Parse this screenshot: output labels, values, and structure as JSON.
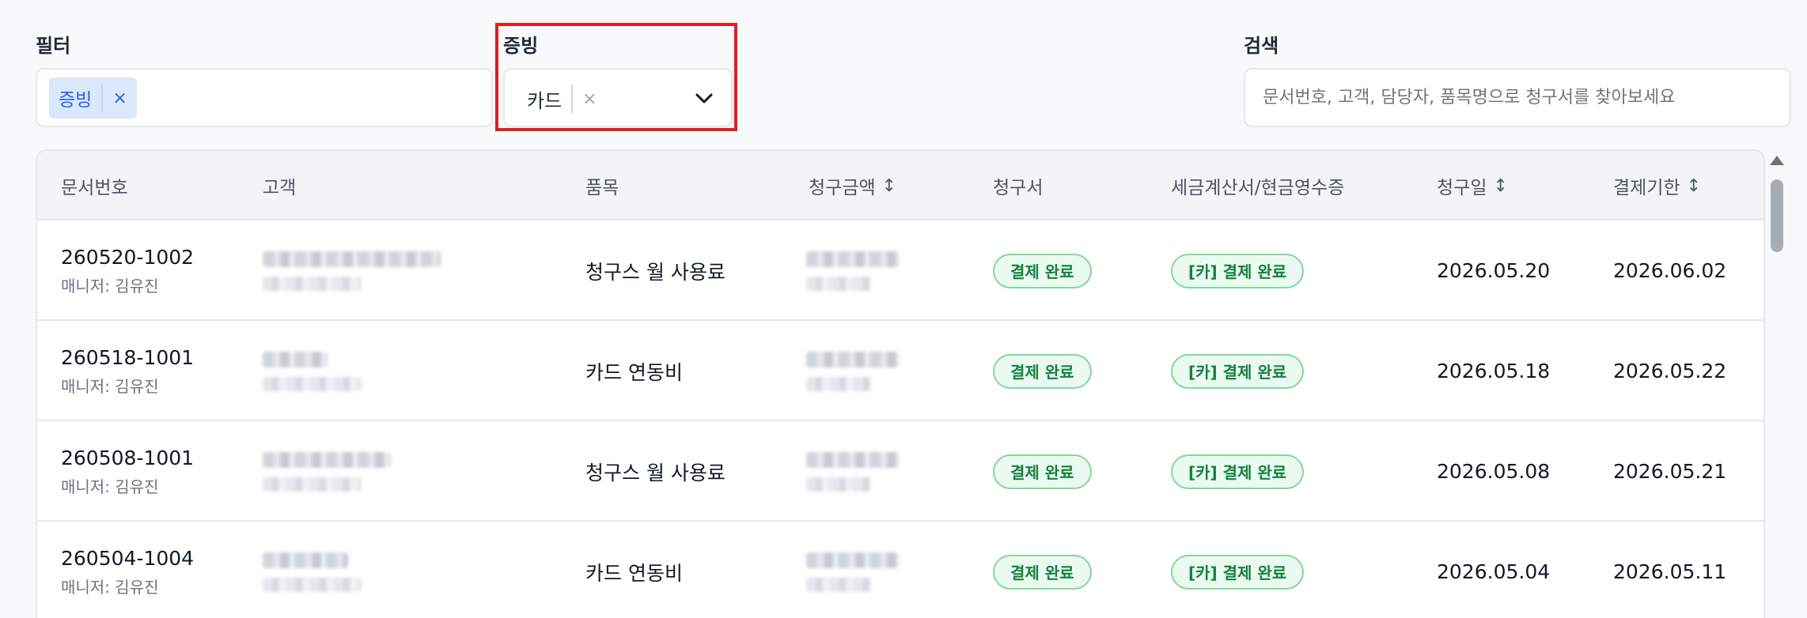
{
  "filters": {
    "filter_label": "필터",
    "filter_chip": "증빙",
    "evidence_label": "증빙",
    "evidence_value": "카드",
    "search_label": "검색",
    "search_placeholder": "문서번호, 고객, 담당자, 품목명으로 청구서를 찾아보세요"
  },
  "icons": {
    "remove": "×",
    "chevron": "chevron-down-icon",
    "sort": "↕"
  },
  "table": {
    "headers": [
      "문서번호",
      "고객",
      "품목",
      "청구금액",
      "청구서",
      "세금계산서/현금영수증",
      "청구일",
      "결제기한"
    ],
    "rows": [
      {
        "doc_no": "260520-1002",
        "manager": "매니저: 김유진",
        "item": "청구스 월 사용료",
        "invoice_status": "결제 완료",
        "tax_status": "[카] 결제 완료",
        "billing_date": "2026.05.20",
        "due_date": "2026.06.02"
      },
      {
        "doc_no": "260518-1001",
        "manager": "매니저: 김유진",
        "item": "카드 연동비",
        "invoice_status": "결제 완료",
        "tax_status": "[카] 결제 완료",
        "billing_date": "2026.05.18",
        "due_date": "2026.05.22"
      },
      {
        "doc_no": "260508-1001",
        "manager": "매니저: 김유진",
        "item": "청구스 월 사용료",
        "invoice_status": "결제 완료",
        "tax_status": "[카] 결제 완료",
        "billing_date": "2026.05.08",
        "due_date": "2026.05.21"
      },
      {
        "doc_no": "260504-1004",
        "manager": "매니저: 김유진",
        "item": "카드 연동비",
        "invoice_status": "결제 완료",
        "tax_status": "[카] 결제 완료",
        "billing_date": "2026.05.04",
        "due_date": "2026.05.11"
      }
    ]
  },
  "colors": {
    "highlight": "#e11d21",
    "chip_bg": "#dbe7fb",
    "chip_text": "#2563eb",
    "badge_border": "#86d69c",
    "badge_text": "#15803d"
  }
}
